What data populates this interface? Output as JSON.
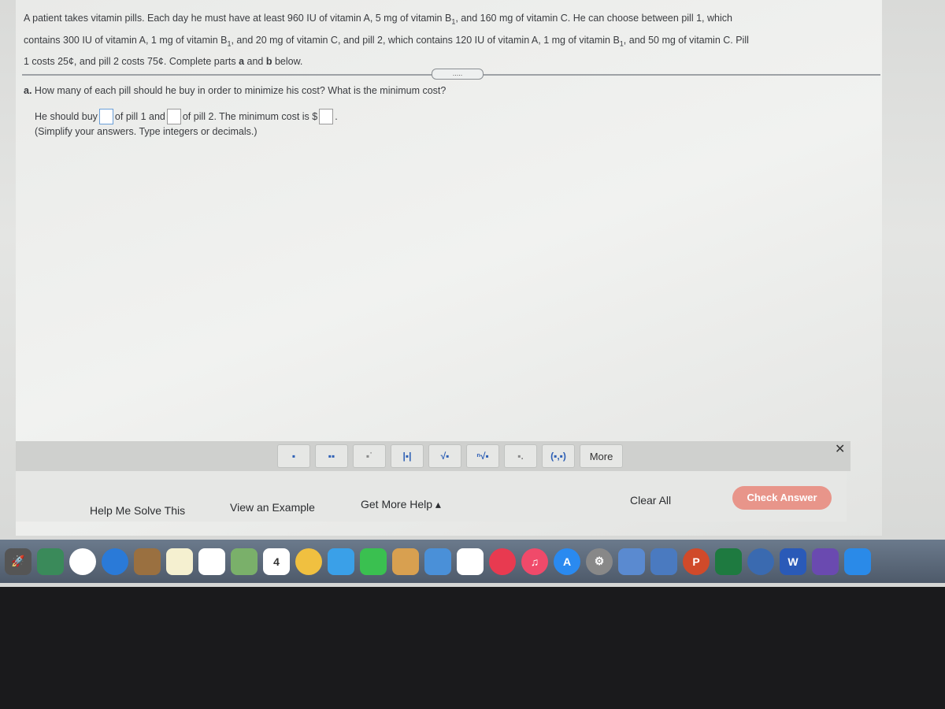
{
  "problem": {
    "l1a": "A patient takes vitamin pills. Each day he must have at least 960 IU of vitamin A, 5 mg of vitamin B",
    "l1b": ", and 160 mg of vitamin C. He can choose between pill 1, which",
    "l2a": "contains 300 IU of vitamin A, 1 mg of vitamin B",
    "l2b": ", and 20 mg of vitamin C, and pill 2, which contains 120 IU of vitamin A, 1 mg of vitamin B",
    "l2c": ", and 50 mg of vitamin C. Pill",
    "l3a": "1 costs 25¢, and pill 2 costs 75¢. Complete parts ",
    "l3b": "a",
    "l3c": " and ",
    "l3d": "b",
    "l3e": " below.",
    "sub": "1",
    "dots": "....."
  },
  "part_a": {
    "label": "a.",
    "question": " How many of each pill should he buy in order to minimize his cost? What is the minimum cost?",
    "t1": "He should buy",
    "t2": "of pill 1 and",
    "t3": "of pill 2. The minimum cost is $",
    "t4": ".",
    "pill1_value": "",
    "pill2_value": "",
    "cost_value": "",
    "hint": "(Simplify your answers. Type integers or decimals.)"
  },
  "toolbar": {
    "buttons": [
      "fraction",
      "mixed-number",
      "exponent",
      "absolute-value",
      "square-root",
      "nth-root",
      "subscript",
      "ordered-pair"
    ],
    "more": "More",
    "close": "✕"
  },
  "footer": {
    "help": "Help Me Solve This",
    "example": "View an Example",
    "more_help": "Get More Help ▴",
    "clear": "Clear All",
    "check": "Check Answer"
  },
  "dock": {
    "calendar_day": "4",
    "word_letter": "W",
    "ppt_letter": "P"
  }
}
